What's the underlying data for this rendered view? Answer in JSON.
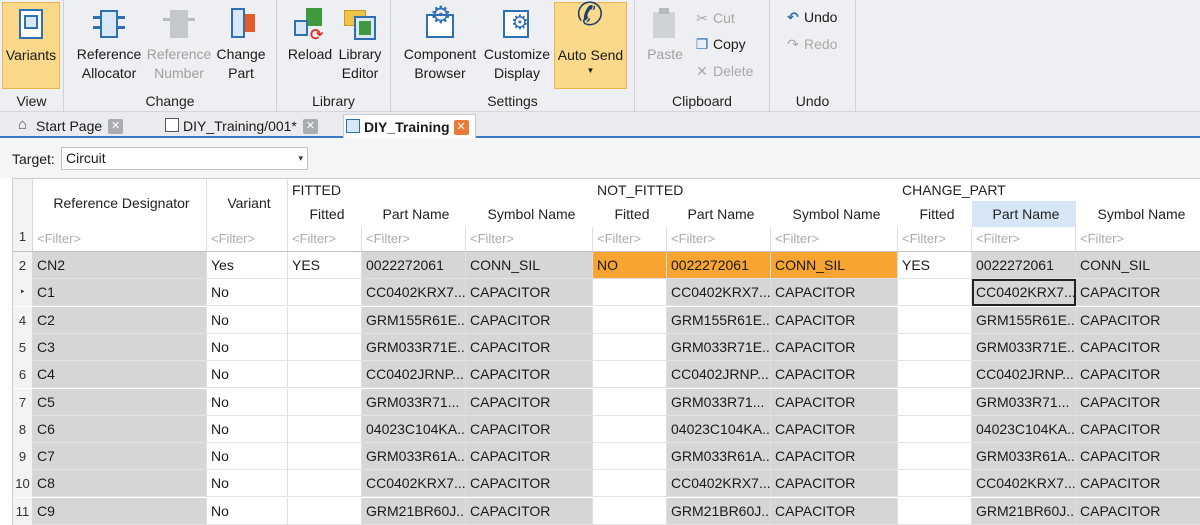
{
  "ribbon": {
    "groups": {
      "view": "View",
      "change": "Change",
      "library": "Library",
      "settings": "Settings",
      "clipboard": "Clipboard",
      "undo": "Undo"
    },
    "buttons": {
      "variants": "Variants",
      "reference_allocator_1": "Reference",
      "reference_allocator_2": "Allocator",
      "reference_number_1": "Reference",
      "reference_number_2": "Number",
      "change_part_1": "Change",
      "change_part_2": "Part",
      "reload": "Reload",
      "library_editor_1": "Library",
      "library_editor_2": "Editor",
      "component_browser_1": "Component",
      "component_browser_2": "Browser",
      "customize_display_1": "Customize",
      "customize_display_2": "Display",
      "auto_send": "Auto Send",
      "paste": "Paste",
      "cut": "Cut",
      "copy": "Copy",
      "delete": "Delete",
      "undo": "Undo",
      "redo": "Redo"
    }
  },
  "tabs": [
    {
      "label": "Start Page"
    },
    {
      "label": "DIY_Training/001*"
    },
    {
      "label": "DIY_Training"
    }
  ],
  "target": {
    "label": "Target:",
    "value": "Circuit"
  },
  "grid": {
    "header_row_number": "1",
    "col_reference": "Reference Designator",
    "col_variant": "Variant",
    "groups": [
      "FITTED",
      "NOT_FITTED",
      "CHANGE_PART"
    ],
    "sub_fitted": "Fitted",
    "sub_part": "Part Name",
    "sub_symbol": "Symbol Name",
    "filter": "<Filter>",
    "current_row_marker": "‣",
    "rows": [
      {
        "num": "2",
        "ref": "CN2",
        "variant": "Yes",
        "f_fitted": "YES",
        "f_part": "0022272061",
        "f_symbol": "CONN_SIL",
        "n_fitted": "NO",
        "n_part": "0022272061",
        "n_symbol": "CONN_SIL",
        "c_fitted": "YES",
        "c_part": "0022272061",
        "c_symbol": "CONN_SIL"
      },
      {
        "num": "",
        "ref": "C1",
        "variant": "No",
        "f_fitted": "",
        "f_part": "CC0402KRX7...",
        "f_symbol": "CAPACITOR",
        "n_fitted": "",
        "n_part": "CC0402KRX7...",
        "n_symbol": "CAPACITOR",
        "c_fitted": "",
        "c_part": "CC0402KRX7...",
        "c_symbol": "CAPACITOR"
      },
      {
        "num": "4",
        "ref": "C2",
        "variant": "No",
        "f_fitted": "",
        "f_part": "GRM155R61E...",
        "f_symbol": "CAPACITOR",
        "n_fitted": "",
        "n_part": "GRM155R61E...",
        "n_symbol": "CAPACITOR",
        "c_fitted": "",
        "c_part": "GRM155R61E...",
        "c_symbol": "CAPACITOR"
      },
      {
        "num": "5",
        "ref": "C3",
        "variant": "No",
        "f_fitted": "",
        "f_part": "GRM033R71E...",
        "f_symbol": "CAPACITOR",
        "n_fitted": "",
        "n_part": "GRM033R71E...",
        "n_symbol": "CAPACITOR",
        "c_fitted": "",
        "c_part": "GRM033R71E...",
        "c_symbol": "CAPACITOR"
      },
      {
        "num": "6",
        "ref": "C4",
        "variant": "No",
        "f_fitted": "",
        "f_part": "CC0402JRNP...",
        "f_symbol": "CAPACITOR",
        "n_fitted": "",
        "n_part": "CC0402JRNP...",
        "n_symbol": "CAPACITOR",
        "c_fitted": "",
        "c_part": "CC0402JRNP...",
        "c_symbol": "CAPACITOR"
      },
      {
        "num": "7",
        "ref": "C5",
        "variant": "No",
        "f_fitted": "",
        "f_part": "GRM033R71...",
        "f_symbol": "CAPACITOR",
        "n_fitted": "",
        "n_part": "GRM033R71...",
        "n_symbol": "CAPACITOR",
        "c_fitted": "",
        "c_part": "GRM033R71...",
        "c_symbol": "CAPACITOR"
      },
      {
        "num": "8",
        "ref": "C6",
        "variant": "No",
        "f_fitted": "",
        "f_part": "04023C104KA...",
        "f_symbol": "CAPACITOR",
        "n_fitted": "",
        "n_part": "04023C104KA...",
        "n_symbol": "CAPACITOR",
        "c_fitted": "",
        "c_part": "04023C104KA...",
        "c_symbol": "CAPACITOR"
      },
      {
        "num": "9",
        "ref": "C7",
        "variant": "No",
        "f_fitted": "",
        "f_part": "GRM033R61A...",
        "f_symbol": "CAPACITOR",
        "n_fitted": "",
        "n_part": "GRM033R61A...",
        "n_symbol": "CAPACITOR",
        "c_fitted": "",
        "c_part": "GRM033R61A...",
        "c_symbol": "CAPACITOR"
      },
      {
        "num": "10",
        "ref": "C8",
        "variant": "No",
        "f_fitted": "",
        "f_part": "CC0402KRX7...",
        "f_symbol": "CAPACITOR",
        "n_fitted": "",
        "n_part": "CC0402KRX7...",
        "n_symbol": "CAPACITOR",
        "c_fitted": "",
        "c_part": "CC0402KRX7...",
        "c_symbol": "CAPACITOR"
      },
      {
        "num": "11",
        "ref": "C9",
        "variant": "No",
        "f_fitted": "",
        "f_part": "GRM21BR60J...",
        "f_symbol": "CAPACITOR",
        "n_fitted": "",
        "n_part": "GRM21BR60J...",
        "n_symbol": "CAPACITOR",
        "c_fitted": "",
        "c_part": "GRM21BR60J...",
        "c_symbol": "CAPACITOR"
      }
    ]
  },
  "colors": {
    "accent": "#3a78c4",
    "active_button": "#fbd98a",
    "not_fitted_highlight": "#f8a431",
    "cell_gray": "#d6d6d6"
  }
}
